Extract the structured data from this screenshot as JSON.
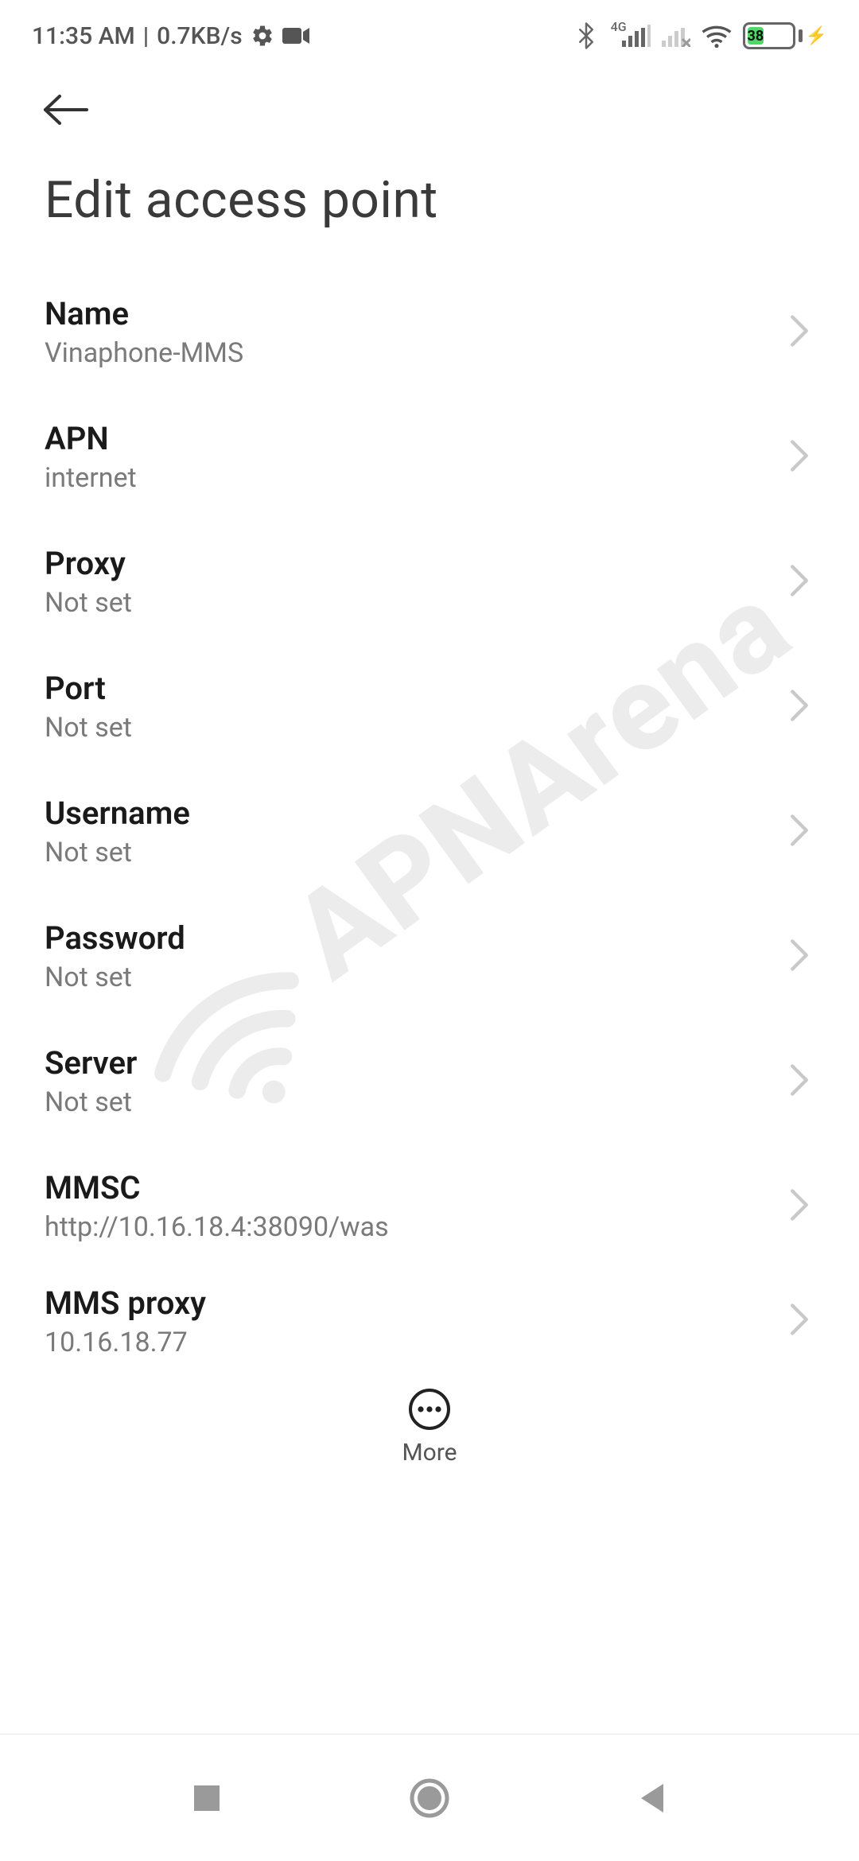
{
  "status": {
    "time": "11:35 AM",
    "net_speed": "0.7KB/s",
    "net_label": "4G",
    "battery_pct": "38"
  },
  "header": {
    "title": "Edit access point"
  },
  "fields": {
    "name": {
      "label": "Name",
      "value": "Vinaphone-MMS"
    },
    "apn": {
      "label": "APN",
      "value": "internet"
    },
    "proxy": {
      "label": "Proxy",
      "value": "Not set"
    },
    "port": {
      "label": "Port",
      "value": "Not set"
    },
    "username": {
      "label": "Username",
      "value": "Not set"
    },
    "password": {
      "label": "Password",
      "value": "Not set"
    },
    "server": {
      "label": "Server",
      "value": "Not set"
    },
    "mmsc": {
      "label": "MMSC",
      "value": "http://10.16.18.4:38090/was"
    },
    "mmsproxy": {
      "label": "MMS proxy",
      "value": "10.16.18.77"
    }
  },
  "actions": {
    "more_label": "More"
  },
  "watermark": {
    "text": "APNArena"
  }
}
